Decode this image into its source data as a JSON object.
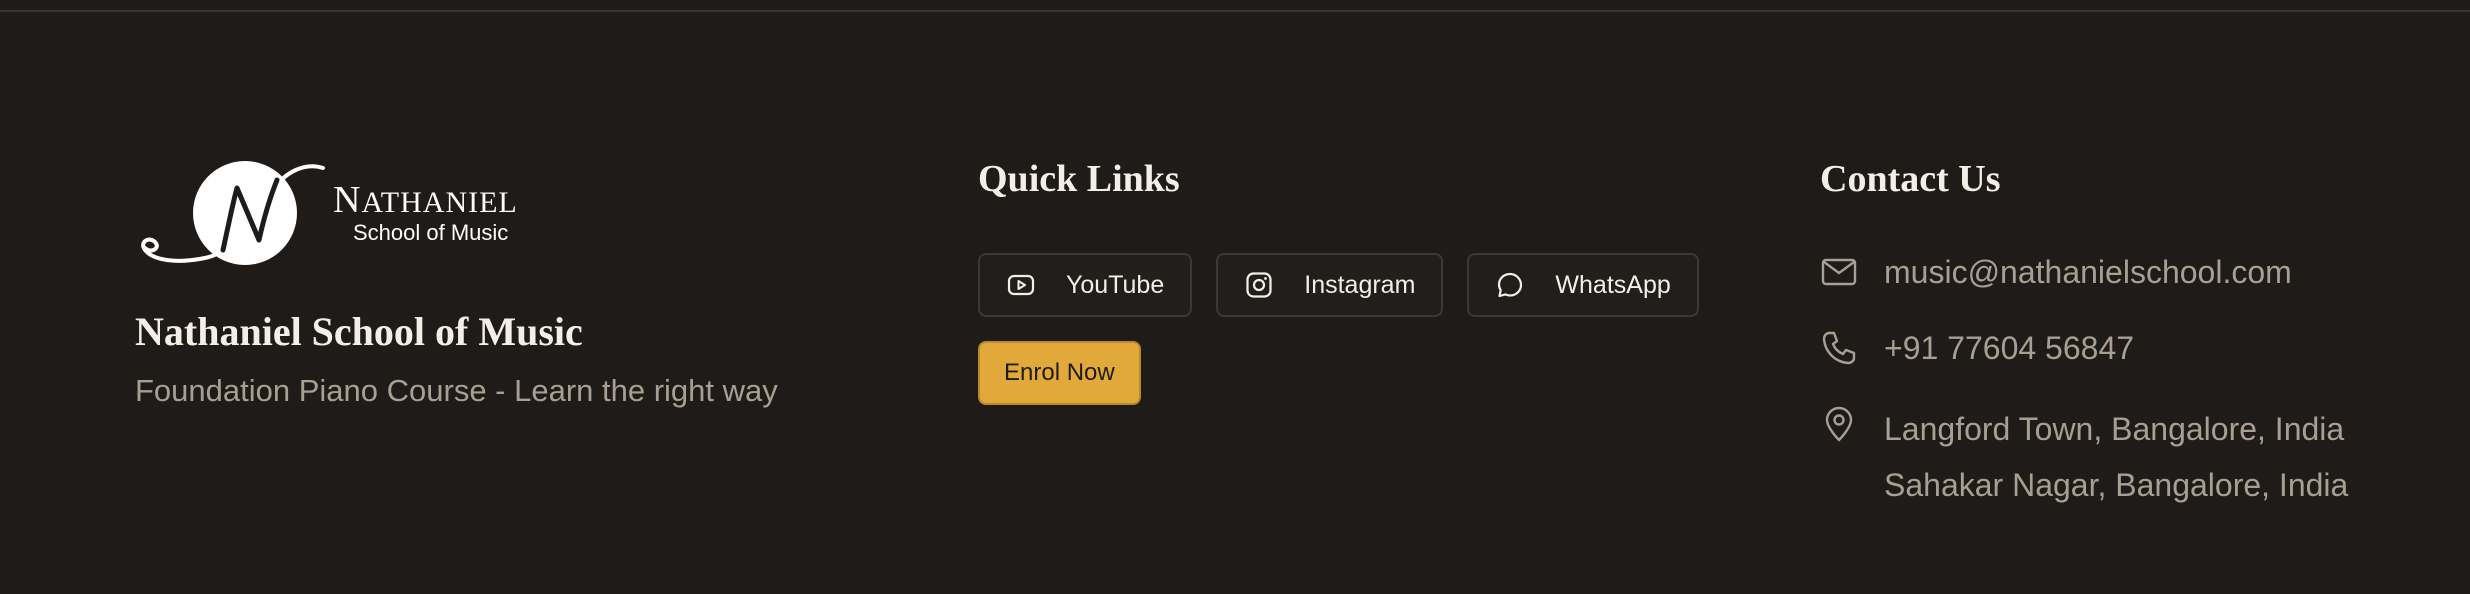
{
  "brand": {
    "logo_word_cap": "N",
    "logo_word_rest": "ATHANIEL",
    "logo_sub": "School of Music",
    "school_name": "Nathaniel School of Music",
    "tagline": "Foundation Piano Course - Learn the right way"
  },
  "quick_links": {
    "heading": "Quick Links",
    "social": [
      {
        "label": "YouTube",
        "icon": "youtube-icon"
      },
      {
        "label": "Instagram",
        "icon": "instagram-icon"
      },
      {
        "label": "WhatsApp",
        "icon": "whatsapp-icon"
      }
    ],
    "enrol_label": "Enrol Now"
  },
  "contact": {
    "heading": "Contact Us",
    "email": "music@nathanielschool.com",
    "phone": "+91 77604 56847",
    "addresses": [
      "Langford Town, Bangalore, India",
      "Sahakar Nagar, Bangalore, India"
    ]
  },
  "colors": {
    "background": "#1f1b19",
    "accent": "#e0a93a",
    "muted_text": "#a89f92",
    "heading_text": "#f4efe6"
  }
}
